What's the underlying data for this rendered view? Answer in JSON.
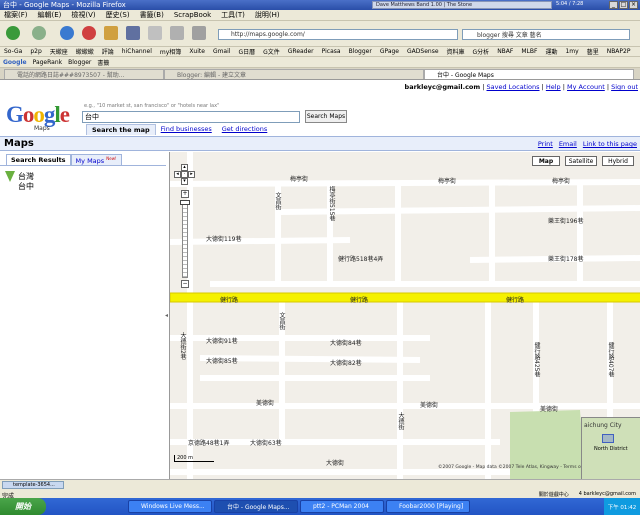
{
  "window": {
    "title": "台中 - Google Maps - Mozilla Firefox",
    "media_player": "Dave Matthews Band 1.00 | The Stone",
    "clock": "5:04 / 7:28"
  },
  "menu": [
    "檔案(F)",
    "編輯(E)",
    "檢視(V)",
    "歷史(S)",
    "書籤(B)",
    "ScrapBook",
    "工具(T)",
    "說明(H)"
  ],
  "nav": {
    "url": "http://maps.google.com/",
    "search_value": "blogger 搜尋 文章 藝名"
  },
  "bookmarks": [
    "So-Ga",
    "p2p",
    "天蠍座",
    "蠍蠍蠍",
    "評論",
    "hiChannel",
    "my相簿",
    "Xuite",
    "Gmail",
    "G日曆",
    "G文件",
    "GReader",
    "Picasa",
    "Blogger",
    "GPage",
    "GADSense",
    "資料庫",
    "G分析",
    "NBAF",
    "MLBF",
    "運動",
    "1my",
    "藝里",
    "NBAP2P"
  ],
  "google_toolbar": [
    "Google",
    "PageRank",
    "Blogger",
    "書籤"
  ],
  "tabs": [
    {
      "label": "電話的網路日誌###8973507 - 幫助...",
      "active": false
    },
    {
      "label": "Blogger: 編輯 - 建立文章",
      "active": false
    },
    {
      "label": "台中 - Google Maps",
      "active": true
    }
  ],
  "header": {
    "email": "barkleyc@gmail.com",
    "links": [
      "Saved Locations",
      "Help",
      "My Account",
      "Sign out"
    ],
    "logo": "Google",
    "logo_sub": "Maps",
    "hint": "e.g., \"10 market st, san francisco\" or \"hotels near lax\"",
    "query": "台中",
    "search_button": "Search Maps",
    "search_tabs": [
      "Search the map",
      "Find businesses",
      "Get directions"
    ]
  },
  "mapsbar": {
    "title": "Maps",
    "print": "Print",
    "email": "Email",
    "link": "Link to this page"
  },
  "sidebar": {
    "tab_results": "Search Results",
    "tab_mymaps": "My Maps",
    "new_badge": "New!",
    "result_title": "台灣",
    "result_sub": "台中"
  },
  "map": {
    "types": [
      "Map",
      "Satellite",
      "Hybrid"
    ],
    "selected_type": "Map",
    "streets": [
      "梅亭街",
      "梅亭街",
      "梅亭街",
      "樂王街196巷",
      "大德街119巷",
      "健行路518巷4弄",
      "樂王街178巷",
      "健行路",
      "健行路",
      "健行路",
      "大德街91巷",
      "大德街84巷",
      "大德街85巷",
      "大德街82巷",
      "美德街",
      "美德街",
      "美德街",
      "京德路48巷1弄",
      "大德街63巷",
      "大德街",
      "文昌街",
      "文昌街",
      "健行路425巷",
      "健行路407巷",
      "大德街2巷",
      "大德街",
      "梅亭街515巷"
    ],
    "scale": "200 m",
    "copyright": "©2007 Google - Map data ©2007 Tele Atlas, Kingway - Terms of Use",
    "overview_city": "aichung City",
    "overview_label": "North District"
  },
  "status": {
    "download": "template-3654...",
    "state": "完成",
    "right_items": [
      "關於遊戲中心",
      "4 barkleyc@gmail.com"
    ]
  },
  "taskbar": {
    "start": "開始",
    "items": [
      "Windows Live Mess...",
      "台中 - Google Maps...",
      "ptt2 - PCMan 2004",
      "Foobar2000 [Playing]"
    ],
    "clock": "下午 01:42"
  },
  "colors": {
    "highway": "#f5f100",
    "road": "#ffffff",
    "land": "#f2efe9",
    "park": "#c8dfb0",
    "accent": "#0000cc"
  }
}
